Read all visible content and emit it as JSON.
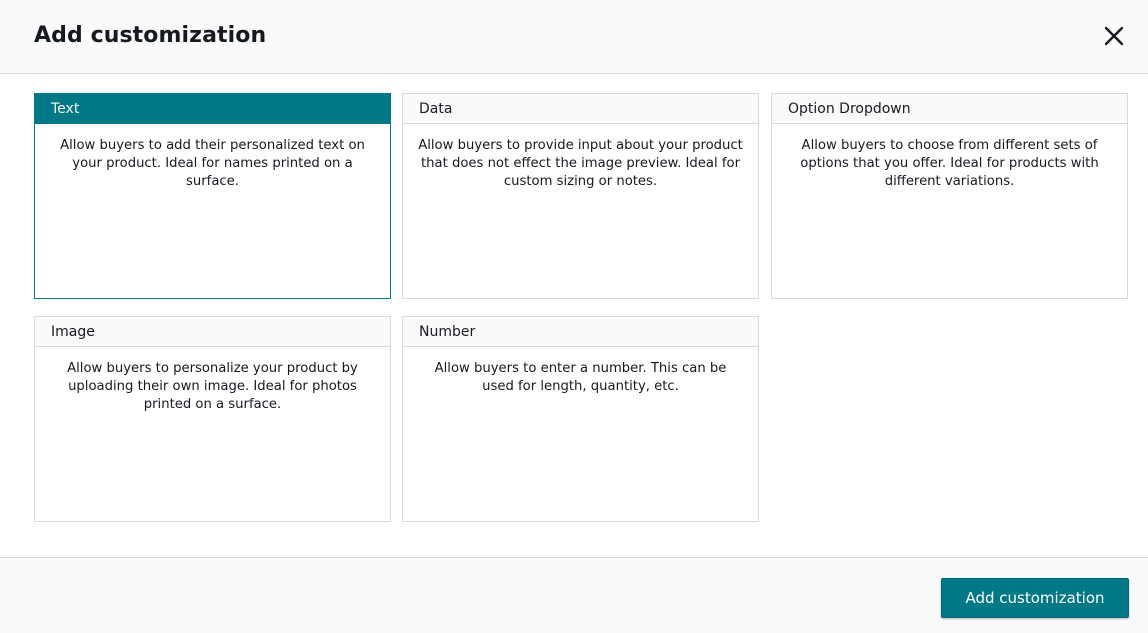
{
  "dialog": {
    "title": "Add customization",
    "close_icon": "close-icon"
  },
  "cards": [
    {
      "label": "Text",
      "description": "Allow buyers to add their personalized text on your product. Ideal for names printed on a surface.",
      "selected": true
    },
    {
      "label": "Data",
      "description": "Allow buyers to provide input about your product that does not effect the image preview. Ideal for custom sizing or notes.",
      "selected": false
    },
    {
      "label": "Option Dropdown",
      "description": "Allow buyers to choose from different sets of options that you offer. Ideal for products with different variations.",
      "selected": false
    },
    {
      "label": "Image",
      "description": "Allow buyers to personalize your product by uploading their own image. Ideal for photos printed on a surface.",
      "selected": false
    },
    {
      "label": "Number",
      "description": "Allow buyers to enter a number. This can be used for length, quantity, etc.",
      "selected": false
    }
  ],
  "footer": {
    "primary_label": "Add customization"
  },
  "colors": {
    "accent": "#007886",
    "border": "#d5dbdb",
    "header_bg": "#fafafa"
  }
}
